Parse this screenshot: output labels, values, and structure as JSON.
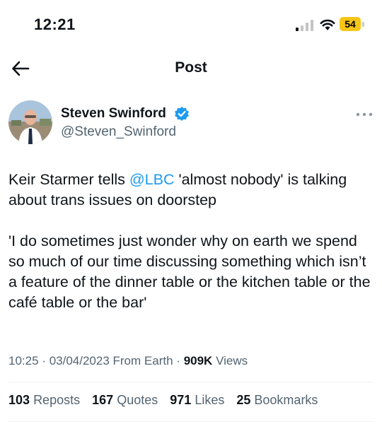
{
  "status_bar": {
    "time": "12:21",
    "battery_level": "54",
    "battery_color": "#f5c518"
  },
  "header": {
    "back_icon": "arrow-left-icon",
    "title": "Post"
  },
  "author": {
    "name": "Steven Swinford",
    "handle": "@Steven_Swinford",
    "verified": true,
    "verified_color": "#1d9bf0"
  },
  "tweet": {
    "line1_prefix": "Keir Starmer tells ",
    "mention": "@LBC",
    "line1_suffix": " 'almost nobody' is talking about trans issues on doorstep",
    "paragraph2": "'I do sometimes just wonder why on earth we spend so much of our time discussing something which isn’t a feature of the dinner table or the kitchen table or the café table or the bar'",
    "mention_color": "#1d9bf0"
  },
  "meta": {
    "time": "10:25",
    "date": "03/04/2023",
    "source": "From Earth",
    "views_count": "909K",
    "views_label": "Views"
  },
  "stats": {
    "reposts_count": "103",
    "reposts_label": "Reposts",
    "quotes_count": "167",
    "quotes_label": "Quotes",
    "likes_count": "971",
    "likes_label": "Likes",
    "bookmarks_count": "25",
    "bookmarks_label": "Bookmarks"
  }
}
